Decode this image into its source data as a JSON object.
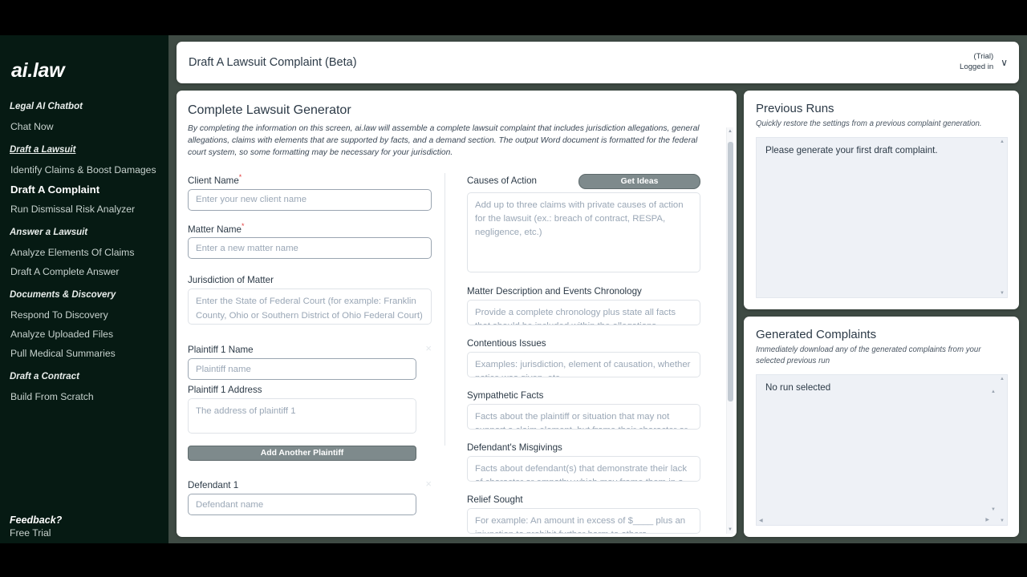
{
  "sidebar": {
    "brand": "ai.law",
    "groups": [
      {
        "heading": "Legal AI Chatbot",
        "underline": false,
        "items": [
          {
            "label": "Chat Now",
            "active": false
          }
        ]
      },
      {
        "heading": "Draft a Lawsuit",
        "underline": true,
        "items": [
          {
            "label": "Identify Claims & Boost Damages",
            "active": false
          },
          {
            "label": "Draft A Complaint",
            "active": true
          },
          {
            "label": "Run Dismissal Risk Analyzer",
            "active": false
          }
        ]
      },
      {
        "heading": "Answer a Lawsuit",
        "underline": false,
        "items": [
          {
            "label": "Analyze Elements Of Claims",
            "active": false
          },
          {
            "label": "Draft A Complete Answer",
            "active": false
          }
        ]
      },
      {
        "heading": "Documents & Discovery",
        "underline": false,
        "items": [
          {
            "label": "Respond To Discovery",
            "active": false
          },
          {
            "label": "Analyze Uploaded Files",
            "active": false
          },
          {
            "label": "Pull Medical Summaries",
            "active": false
          }
        ]
      },
      {
        "heading": "Draft a Contract",
        "underline": false,
        "items": [
          {
            "label": "Build From Scratch",
            "active": false
          }
        ]
      }
    ],
    "footer": {
      "title": "Feedback?",
      "link": "Free Trial"
    }
  },
  "header": {
    "title": "Draft A Lawsuit Complaint (Beta)",
    "plan": "(Trial)",
    "status": "Logged in",
    "chevron": "∨"
  },
  "form": {
    "title": "Complete Lawsuit Generator",
    "description": "By completing the information on this screen, ai.law will assemble a complete lawsuit complaint that includes jurisdiction allegations, general allegations, claims with elements that are supported by facts, and a demand section. The output Word document is formatted for the federal court system, so some formatting may be necessary for your jurisdiction.",
    "left": {
      "client_name": {
        "label": "Client Name",
        "required": "*",
        "value": "",
        "placeholder": "Enter your new client name"
      },
      "matter_name": {
        "label": "Matter Name",
        "required": "*",
        "value": "",
        "placeholder": "Enter a new matter name"
      },
      "jurisdiction": {
        "label": "Jurisdiction of Matter",
        "value": "",
        "placeholder": "Enter the State of Federal Court (for example: Franklin County, Ohio or Southern District of Ohio Federal Court)"
      },
      "plaintiff_name": {
        "label": "Plaintiff 1 Name",
        "value": "",
        "placeholder": "Plaintiff name",
        "remove": "×"
      },
      "plaintiff_address": {
        "label": "Plaintiff 1 Address",
        "value": "",
        "placeholder": "The address of plaintiff 1"
      },
      "add_plaintiff_button": "Add Another Plaintiff",
      "defendant_name": {
        "label": "Defendant 1",
        "value": "",
        "placeholder": "Defendant name",
        "remove": "×"
      }
    },
    "right": {
      "causes": {
        "label": "Causes of Action",
        "button": "Get Ideas",
        "value": "",
        "placeholder": "Add up to three claims with private causes of action for the lawsuit (ex.: breach of contract, RESPA, negligence, etc.)"
      },
      "chronology": {
        "label": "Matter Description and Events Chronology",
        "value": "",
        "placeholder": "Provide a complete chronology plus state all facts that should be included within the allegations."
      },
      "contentious": {
        "label": "Contentious Issues",
        "value": "",
        "placeholder": "Examples: jurisdiction, element of causation, whether notice was given, etc."
      },
      "sympathetic": {
        "label": "Sympathetic Facts",
        "value": "",
        "placeholder": "Facts about the plaintiff or situation that may not support a claim element, but frame their character or situation as sympathetic."
      },
      "misgivings": {
        "label": "Defendant's Misgivings",
        "value": "",
        "placeholder": "Facts about defendant(s) that demonstrate their lack of character or empathy which may frame them in a bad light."
      },
      "relief": {
        "label": "Relief Sought",
        "value": "",
        "placeholder": "For example: An amount in excess of $____ plus an injunction to prohibit further harm to others."
      }
    }
  },
  "previous_runs": {
    "title": "Previous Runs",
    "subtitle": "Quickly restore the settings from a previous complaint generation.",
    "message": "Please generate your first draft complaint."
  },
  "generated_complaints": {
    "title": "Generated Complaints",
    "subtitle": "Immediately download any of the generated complaints from your selected previous run",
    "message": "No run selected"
  }
}
